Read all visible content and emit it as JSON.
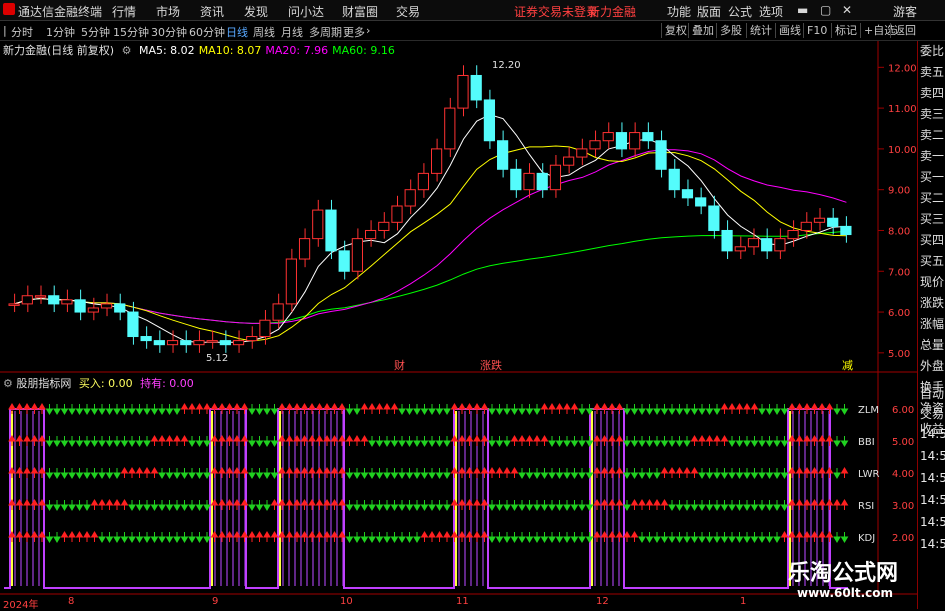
{
  "app": {
    "title": "通达信金融终端"
  },
  "menu": {
    "items": [
      "行情",
      "市场",
      "资讯",
      "发现",
      "问小达",
      "财富圈",
      "交易"
    ],
    "alert": "证券交易未登录",
    "stock": "新力金融",
    "right_items": [
      "功能",
      "版面",
      "公式",
      "选项"
    ],
    "guest": "游客"
  },
  "periods": {
    "items": [
      "分时",
      "1分钟",
      "5分钟",
      "15分钟",
      "30分钟",
      "60分钟",
      "日线",
      "周线",
      "月线",
      "多周期",
      "更多"
    ],
    "active": "日线",
    "buttons": [
      "复权",
      "叠加",
      "多股",
      "统计",
      "画线",
      "F10",
      "标记",
      "+自选",
      "返回"
    ]
  },
  "main_chart": {
    "title": "新力金融(日线 前复权)",
    "ma_labels": [
      {
        "text": "MA5: 8.02",
        "color": "#ffffff"
      },
      {
        "text": "MA10: 8.07",
        "color": "#ffff00"
      },
      {
        "text": "MA20: 7.96",
        "color": "#ff00ff"
      },
      {
        "text": "MA60: 9.16",
        "color": "#00ff00"
      }
    ],
    "y_ticks": [
      "12.00",
      "11.00",
      "10.00",
      "9.00",
      "8.00",
      "7.00",
      "6.00",
      "5.00"
    ],
    "high_label": "12.20",
    "low_label": "5.12",
    "event_markers": [
      "财",
      "涨跌",
      "减"
    ]
  },
  "chart_data": {
    "type": "candlestick",
    "title": "新力金融(日线 前复权)",
    "ylim": [
      4.8,
      12.4
    ],
    "high": 12.2,
    "low": 5.12,
    "ma_last": {
      "MA5": 8.02,
      "MA10": 8.07,
      "MA20": 7.96,
      "MA60": 9.16
    },
    "closes": [
      6.2,
      6.4,
      6.4,
      6.2,
      6.3,
      6.0,
      6.1,
      6.2,
      6.0,
      5.4,
      5.3,
      5.2,
      5.3,
      5.2,
      5.3,
      5.3,
      5.2,
      5.3,
      5.4,
      5.8,
      6.2,
      7.3,
      7.8,
      8.5,
      7.5,
      7.0,
      7.8,
      8.0,
      8.2,
      8.6,
      9.0,
      9.4,
      10.0,
      11.0,
      11.8,
      11.2,
      10.2,
      9.5,
      9.0,
      9.4,
      9.0,
      9.6,
      9.8,
      10.0,
      10.2,
      10.4,
      10.0,
      10.4,
      10.2,
      9.5,
      9.0,
      8.8,
      8.6,
      8.0,
      7.5,
      7.6,
      7.8,
      7.5,
      7.8,
      8.0,
      8.2,
      8.3,
      8.1,
      7.9
    ]
  },
  "indicator": {
    "title": "股朋指标网",
    "buy_label": "买入: 0.00",
    "hold_label": "持有: 0.00",
    "rows": [
      "ZLM",
      "BBI",
      "LWR",
      "RSI",
      "KDJ"
    ],
    "y_ticks": [
      "6.00",
      "5.00",
      "4.00",
      "3.00",
      "2.00"
    ]
  },
  "x_axis": {
    "labels": [
      "2024年",
      "8",
      "9",
      "10",
      "11",
      "12",
      "1"
    ]
  },
  "right_panel": {
    "items": [
      "委比",
      "卖五",
      "卖四",
      "卖三",
      "卖二",
      "卖一",
      "买一",
      "买二",
      "买三",
      "买四",
      "买五",
      "现价",
      "涨跌",
      "涨幅",
      "总量",
      "外盘",
      "换手",
      "净资",
      "收益"
    ],
    "lower_items": [
      "自动",
      "交易"
    ],
    "times": [
      "14:5",
      "14:5",
      "14:5",
      "14:5",
      "14:5",
      "14:5"
    ]
  },
  "watermark": {
    "title": "乐淘公式网",
    "url": "www.60lt.com"
  },
  "colors": {
    "up": "#ff3232",
    "down": "#54fcfc",
    "ma5": "#ffffff",
    "ma10": "#ffff00",
    "ma20": "#ff00ff",
    "ma60": "#00ff00",
    "buy_arrow": "#ff2020",
    "sell_arrow": "#20d020",
    "signal": "#c040ff"
  }
}
